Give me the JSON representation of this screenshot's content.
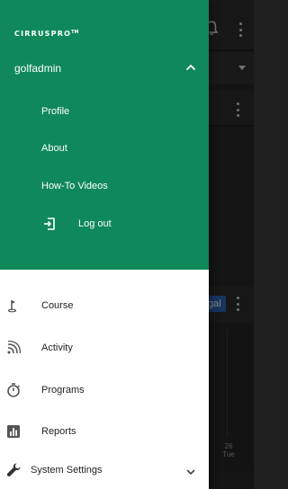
{
  "app": {
    "logo_text": "CIRRUS",
    "logo_pro": "PRO",
    "logo_tm": "TM"
  },
  "account": {
    "username": "golfadmin",
    "expand_icon": "chevron-up-icon"
  },
  "account_menu": [
    {
      "label": "Profile"
    },
    {
      "label": "About"
    },
    {
      "label": "How-To Videos"
    },
    {
      "label": "Log out",
      "icon": "logout-icon"
    }
  ],
  "nav": [
    {
      "label": "Course",
      "icon": "golf-flag-icon"
    },
    {
      "label": "Activity",
      "icon": "signal-waves-icon"
    },
    {
      "label": "Programs",
      "icon": "stopwatch-icon"
    },
    {
      "label": "Reports",
      "icon": "bar-chart-icon"
    },
    {
      "label": "System Settings",
      "icon": "wrench-icon",
      "expand_icon": "chevron-down-icon"
    }
  ],
  "background": {
    "chip_text": "gal",
    "day_number": "26",
    "day_name": "Tue"
  },
  "colors": {
    "header_green": "#10895a",
    "drawer_bg": "#ffffff",
    "nav_text": "#222222",
    "header_text": "#ffffff"
  }
}
